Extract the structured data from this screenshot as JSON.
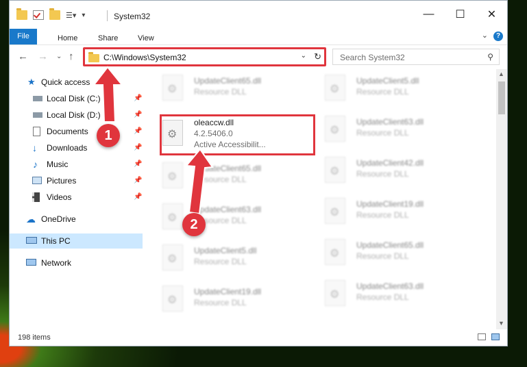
{
  "window": {
    "title": "System32"
  },
  "ribbon": {
    "tabs": [
      "File",
      "Home",
      "Share",
      "View"
    ]
  },
  "address": {
    "path": "C:\\Windows\\System32"
  },
  "search": {
    "placeholder": "Search System32"
  },
  "nav": {
    "items": [
      {
        "label": "Quick access",
        "icon": "star-icon"
      },
      {
        "label": "Local Disk (C:)",
        "icon": "drive-icon",
        "pinned": true
      },
      {
        "label": "Local Disk (D:)",
        "icon": "drive-icon",
        "pinned": true
      },
      {
        "label": "Documents",
        "icon": "document-icon",
        "pinned": true
      },
      {
        "label": "Downloads",
        "icon": "download-icon",
        "pinned": true
      },
      {
        "label": "Music",
        "icon": "music-icon",
        "pinned": true
      },
      {
        "label": "Pictures",
        "icon": "pictures-icon",
        "pinned": true
      },
      {
        "label": "Videos",
        "icon": "video-icon",
        "pinned": true
      },
      {
        "label": "OneDrive",
        "icon": "cloud-icon"
      },
      {
        "label": "This PC",
        "icon": "computer-icon",
        "selected": true
      },
      {
        "label": "Network",
        "icon": "network-icon"
      }
    ]
  },
  "files": {
    "left": [
      {
        "name": "UpdateClient65.dll",
        "desc": "Resource DLL"
      },
      {
        "name": "oleaccw.dll",
        "version": "4.2.5406.0",
        "desc": "Active Accessibilit...",
        "highlighted": true
      },
      {
        "name": "UpdateClient65.dll",
        "desc": "Resource DLL"
      },
      {
        "name": "UpdateClient63.dll",
        "desc": "Resource DLL"
      },
      {
        "name": "UpdateClient5.dll",
        "desc": "Resource DLL"
      },
      {
        "name": "UpdateClient19.dll",
        "desc": "Resource DLL"
      }
    ],
    "right": [
      {
        "name": "UpdateClient5.dll",
        "desc": "Resource DLL"
      },
      {
        "name": "UpdateClient63.dll",
        "desc": "Resource DLL"
      },
      {
        "name": "UpdateClient42.dll",
        "desc": "Resource DLL"
      },
      {
        "name": "UpdateClient19.dll",
        "desc": "Resource DLL"
      },
      {
        "name": "UpdateClient65.dll",
        "desc": "Resource DLL"
      },
      {
        "name": "UpdateClient63.dll",
        "desc": "Resource DLL"
      }
    ]
  },
  "status": {
    "count": "198 items"
  },
  "annotations": {
    "step1": "1",
    "step2": "2"
  },
  "colors": {
    "accent": "#1979ca",
    "highlight": "#e0353d",
    "selected": "#cce8ff"
  }
}
